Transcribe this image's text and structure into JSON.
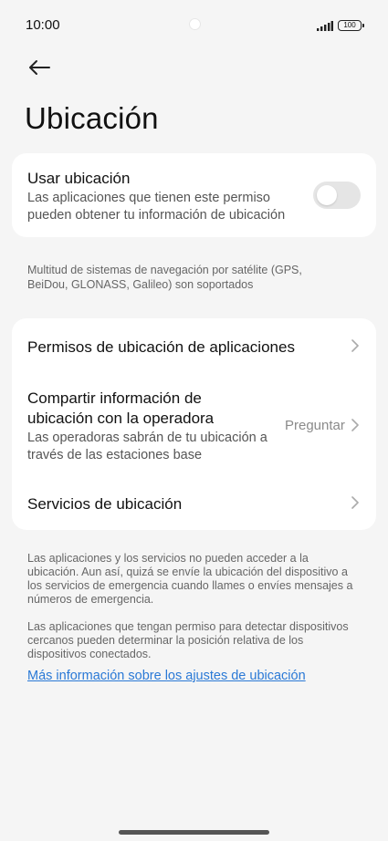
{
  "status_bar": {
    "time": "10:00",
    "battery": "100"
  },
  "header": {
    "back_icon": "arrow-left-icon",
    "title": "Ubicación"
  },
  "location_card": {
    "title": "Usar ubicación",
    "subtitle_line1": "Las aplicaciones que tienen este permiso",
    "subtitle_line2": "pueden obtener tu información de ubicación",
    "toggle_on": false
  },
  "gnss_note": {
    "line1": "Multitud de sistemas de navegación por satélite (GPS,",
    "line2": "BeiDou, GLONASS, Galileo) son soportados"
  },
  "settings_card": {
    "items": [
      {
        "title": "Permisos de ubicación de aplicaciones"
      },
      {
        "title_line1": "Compartir información de",
        "title_line2": "ubicación con la operadora",
        "subtitle_line1": "Las operadoras sabrán de tu ubicación a",
        "subtitle_line2": "través de las estaciones base",
        "value": "Preguntar"
      },
      {
        "title": "Servicios de ubicación"
      }
    ]
  },
  "footer_notes": {
    "note1": [
      "Las aplicaciones y los servicios no pueden acceder a la",
      "ubicación. Aun así, quizá se envíe la ubicación del dispositivo a",
      "los servicios de emergencia cuando llames o envíes mensajes a",
      "números de emergencia."
    ],
    "note2": [
      "Las aplicaciones que tengan permiso para detectar dispositivos",
      "cercanos pueden determinar la posición relativa de los",
      "dispositivos conectados."
    ],
    "link": "Más información sobre los ajustes de ubicación"
  },
  "colors": {
    "background": "#f5f5f5",
    "card": "#ffffff",
    "link": "#2a79d6",
    "toggle_off": "#e5e5e5"
  }
}
